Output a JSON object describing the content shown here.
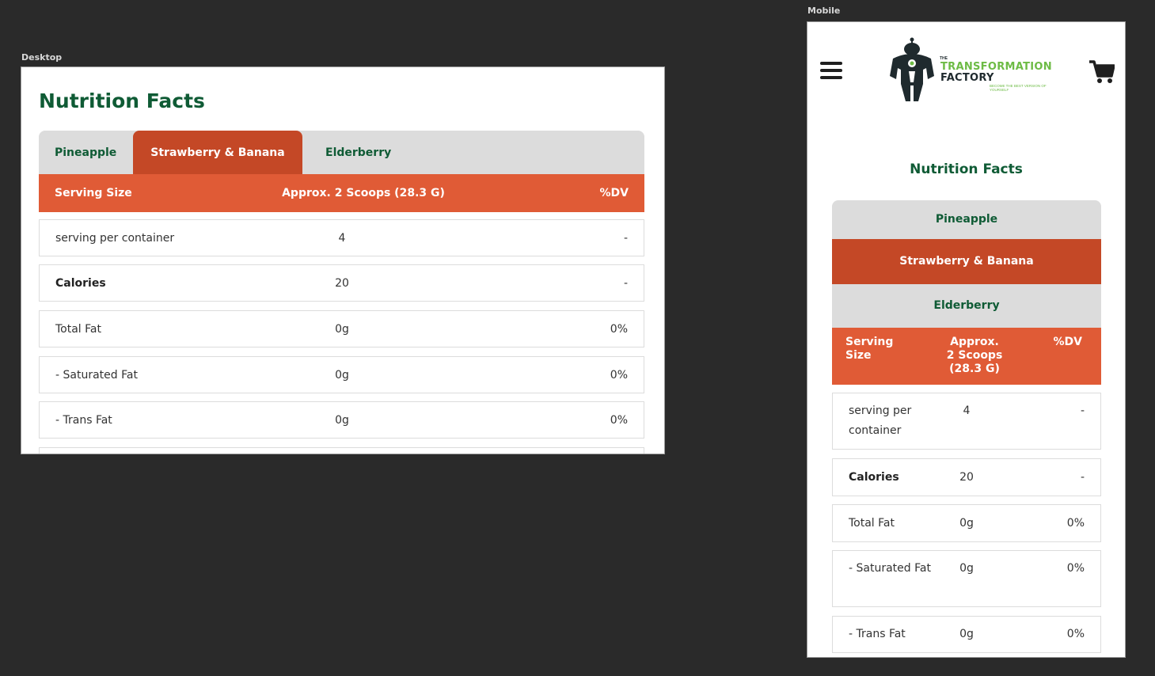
{
  "labels": {
    "desktop": "Desktop",
    "mobile": "Mobile"
  },
  "colors": {
    "green": "#0f5b35",
    "header_orange": "#e05b36",
    "active_tab": "#c44826",
    "tab_bg": "#dcdcdc"
  },
  "nutrition": {
    "title": "Nutrition Facts",
    "tabs": [
      "Pineapple",
      "Strawberry & Banana",
      "Elderberry"
    ],
    "active_tab": "Strawberry & Banana",
    "header": {
      "col1": "Serving Size",
      "col2": "Approx. 2 Scoops (28.3 G)",
      "col3": "%DV"
    },
    "mobile_header": {
      "col1a": "Serving",
      "col1b": "Size",
      "col2a": "Approx.",
      "col2b": "2 Scoops",
      "col2c": "(28.3 G)",
      "col3": "%DV"
    },
    "rows": [
      {
        "name": "serving per container",
        "amount": "4",
        "dv": "-"
      },
      {
        "name": "Calories",
        "amount": "20",
        "dv": "-"
      },
      {
        "name": "Total Fat",
        "amount": "0g",
        "dv": "0%"
      },
      {
        "name": "- Saturated Fat",
        "amount": "0g",
        "dv": "0%"
      },
      {
        "name": "- Trans Fat",
        "amount": "0g",
        "dv": "0%"
      }
    ]
  },
  "logo": {
    "the": "THE",
    "line1": "TRANSFORMATION",
    "line2": "FACTORY",
    "tagline": "BECOME THE BEST VERSION OF YOURSELF"
  },
  "icons": {
    "menu": "hamburger-menu-icon",
    "cart": "shopping-cart-icon"
  }
}
